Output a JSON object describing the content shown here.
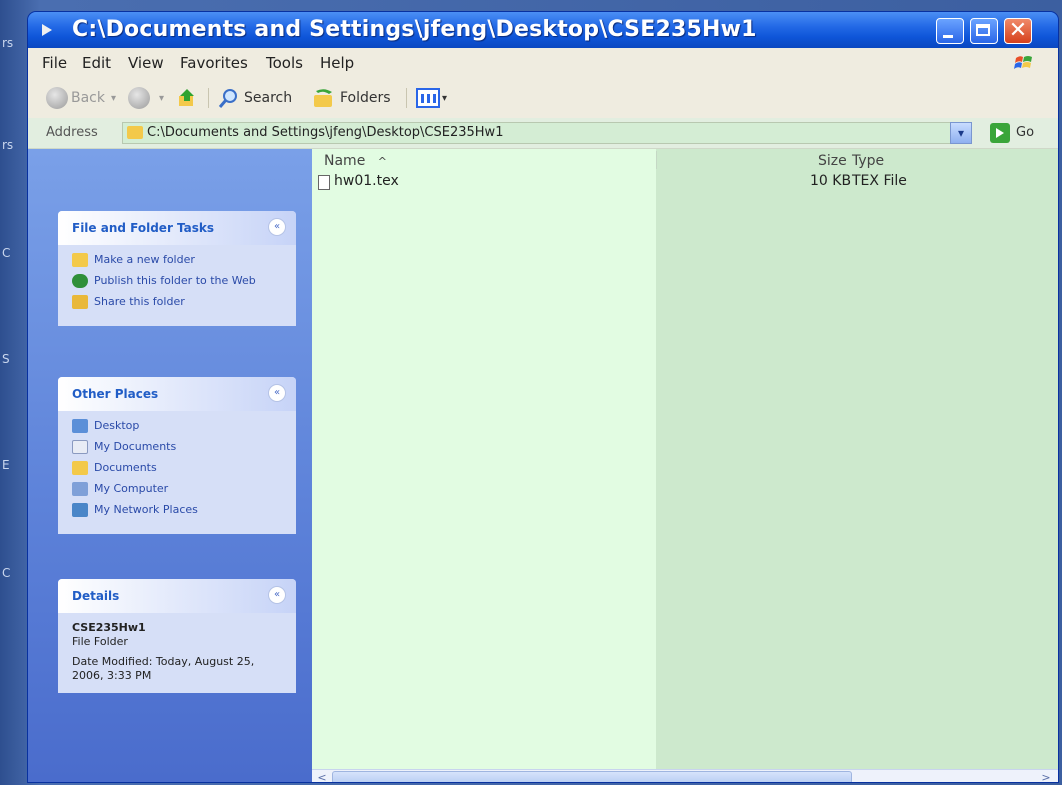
{
  "desktop": {
    "side_labels": [
      "rs",
      "rs",
      "C",
      "S",
      "E",
      "C"
    ]
  },
  "window": {
    "title": "C:\\Documents and Settings\\jfeng\\Desktop\\CSE235Hw1",
    "close_glyph": "✕"
  },
  "menubar": {
    "items": [
      "File",
      "Edit",
      "View",
      "Favorites",
      "Tools",
      "Help"
    ]
  },
  "toolbar": {
    "back_label": "Back",
    "search_label": "Search",
    "folders_label": "Folders"
  },
  "address": {
    "label": "Address",
    "value": "C:\\Documents and Settings\\jfeng\\Desktop\\CSE235Hw1",
    "dropdown_glyph": "▾",
    "go_label": "Go"
  },
  "panels": {
    "tasks": {
      "title": "File and Folder Tasks",
      "chevron": "«",
      "items": [
        "Make a new folder",
        "Publish this folder to the Web",
        "Share this folder"
      ]
    },
    "places": {
      "title": "Other Places",
      "chevron": "«",
      "items": [
        "Desktop",
        "My Documents",
        "Documents",
        "My Computer",
        "My Network Places"
      ]
    },
    "details": {
      "title": "Details",
      "chevron": "«",
      "name": "CSE235Hw1",
      "kind": "File Folder",
      "modified": "Date Modified: Today, August 25, 2006, 3:33 PM"
    }
  },
  "filelist": {
    "columns": {
      "name": "Name",
      "sort_glyph": "^",
      "size": "Size",
      "type": "Type"
    },
    "rows": [
      {
        "name": "hw01.tex",
        "size": "10 KB",
        "type": "TEX File"
      }
    ]
  },
  "scroll": {
    "left": "<",
    "right": ">"
  }
}
